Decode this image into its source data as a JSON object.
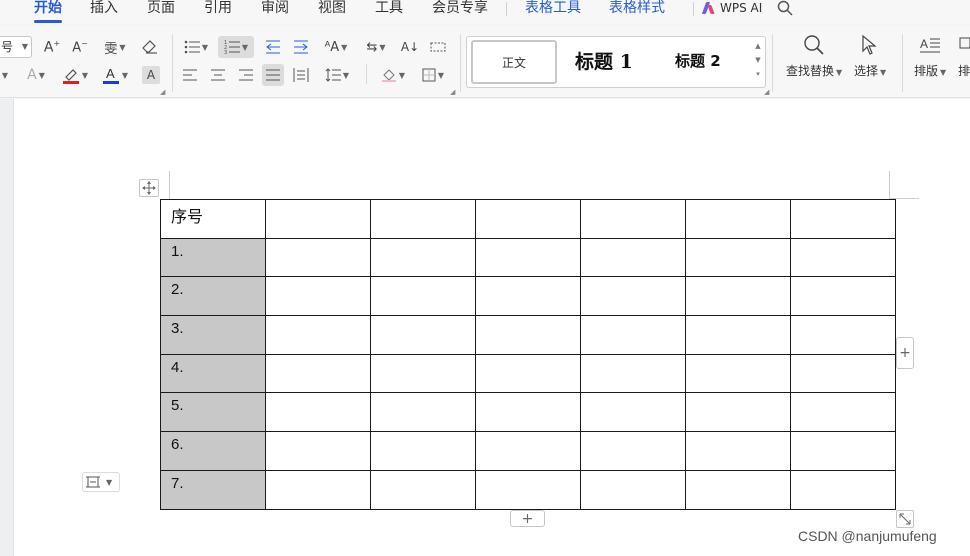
{
  "menu": {
    "tabs": [
      "开始",
      "插入",
      "页面",
      "引用",
      "审阅",
      "视图",
      "工具",
      "会员专享"
    ],
    "context_tabs": [
      "表格工具",
      "表格样式"
    ],
    "ai_label": "WPS AI",
    "colors": {
      "accent": "#2a5bd7"
    }
  },
  "ribbon": {
    "font_size_partial": "号",
    "styles": {
      "normal": "正文",
      "heading1": "标题 1",
      "heading2": "标题 2"
    },
    "find_replace": "查找替换",
    "select": "选择",
    "layout": "排版",
    "arrange_partial": "排",
    "font_color": "#1f3bd6",
    "highlight_color": "#e02020"
  },
  "table": {
    "header": [
      "序号",
      "",
      "",
      "",
      "",
      "",
      ""
    ],
    "rows": [
      [
        "1.",
        "",
        "",
        "",
        "",
        "",
        ""
      ],
      [
        "2.",
        "",
        "",
        "",
        "",
        "",
        ""
      ],
      [
        "3.",
        "",
        "",
        "",
        "",
        "",
        ""
      ],
      [
        "4.",
        "",
        "",
        "",
        "",
        "",
        ""
      ],
      [
        "5.",
        "",
        "",
        "",
        "",
        "",
        ""
      ],
      [
        "6.",
        "",
        "",
        "",
        "",
        "",
        ""
      ],
      [
        "7.",
        "",
        "",
        "",
        "",
        "",
        ""
      ]
    ],
    "first_column_shading": "#c8c8c8",
    "add_symbol": "+"
  },
  "watermark": "CSDN @nanjumufeng"
}
